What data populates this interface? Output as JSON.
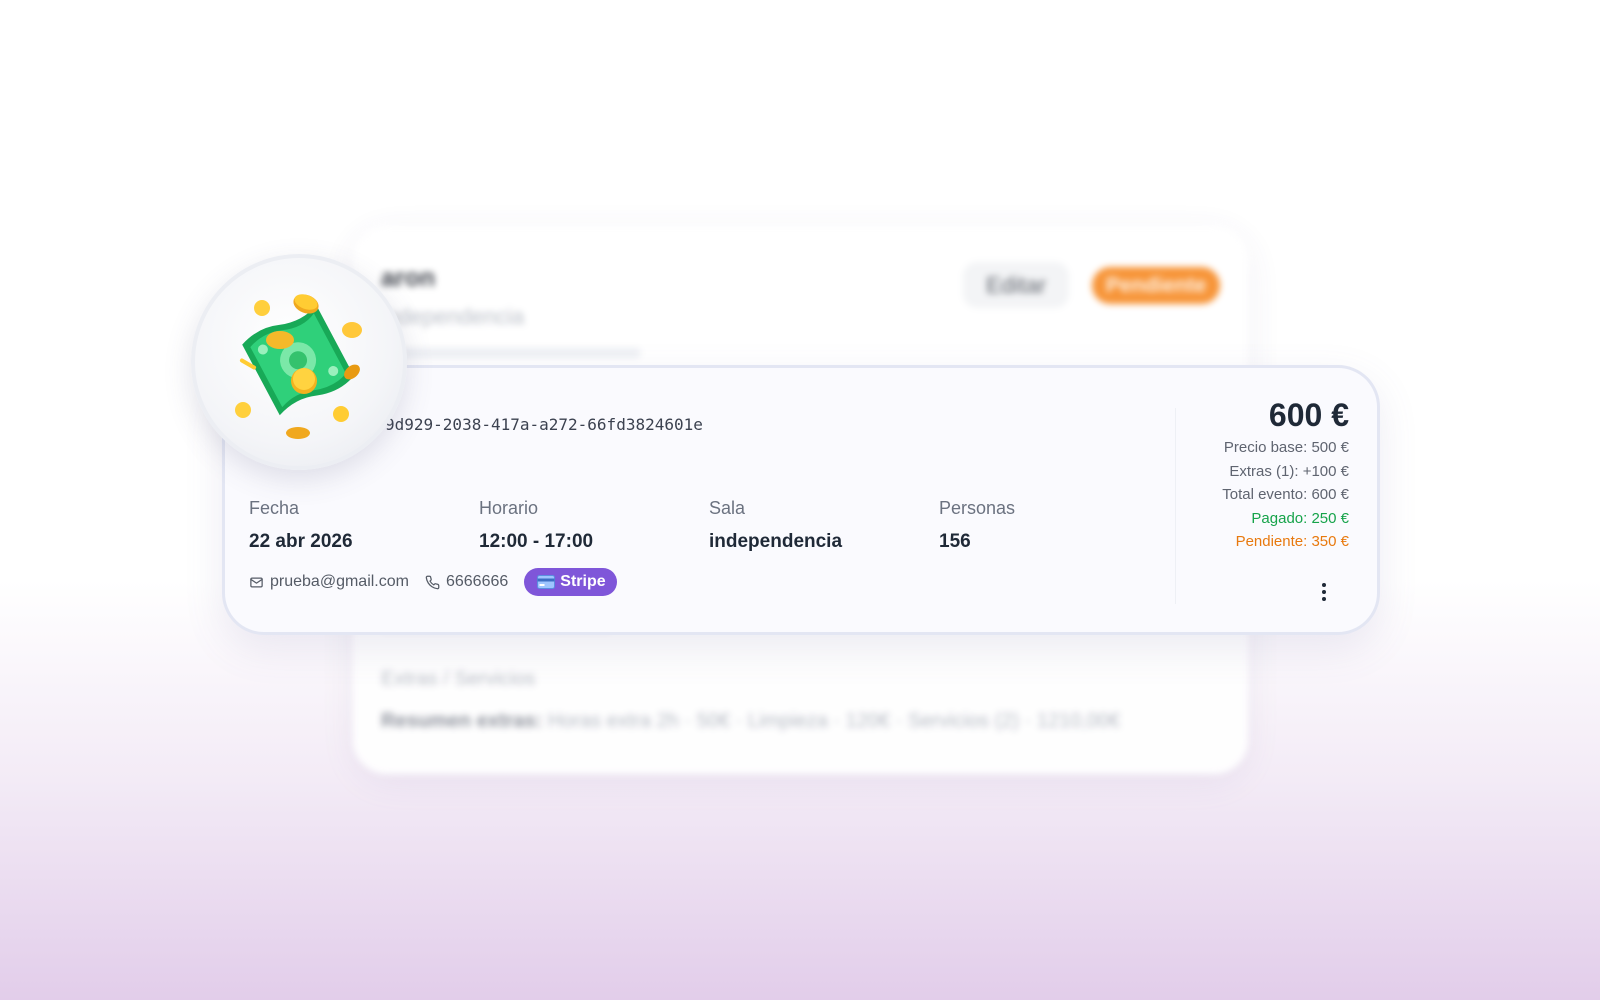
{
  "background_card": {
    "client_name": "aron",
    "room": "independencia",
    "edit_label": "Editar",
    "status_label": "Pendiente",
    "extras_title": "Extras / Servicios",
    "extras_summary_label": "Resumen extras:",
    "extras_summary_value": "Horas extra 2h · 50€ · Limpieza · 120€ · Servicios (2) · 1210,00€"
  },
  "booking": {
    "id": "9d929-2038-417a-a272-66fd3824601e",
    "fields": [
      {
        "label": "Fecha",
        "value": "22 abr 2026"
      },
      {
        "label": "Horario",
        "value": "12:00 - 17:00"
      },
      {
        "label": "Sala",
        "value": "independencia"
      },
      {
        "label": "Personas",
        "value": "156"
      }
    ],
    "email": "prueba@gmail.com",
    "phone": "6666666",
    "payment_method": "Stripe"
  },
  "totals": {
    "total": "600 €",
    "base_price": "Precio base: 500 €",
    "extras": "Extras (1): +100 €",
    "event_total": "Total evento: 600 €",
    "paid": "Pagado: 250 €",
    "pending": "Pendiente: 350 €"
  },
  "colors": {
    "status_pending": "#f7902f",
    "stripe": "#7f56d9",
    "paid": "#16a34a",
    "pending": "#e8790e"
  },
  "icons": {
    "email": "mail-icon",
    "phone": "phone-icon",
    "payment": "credit-card-icon",
    "more": "more-vertical-icon",
    "illustration": "money-icon"
  }
}
